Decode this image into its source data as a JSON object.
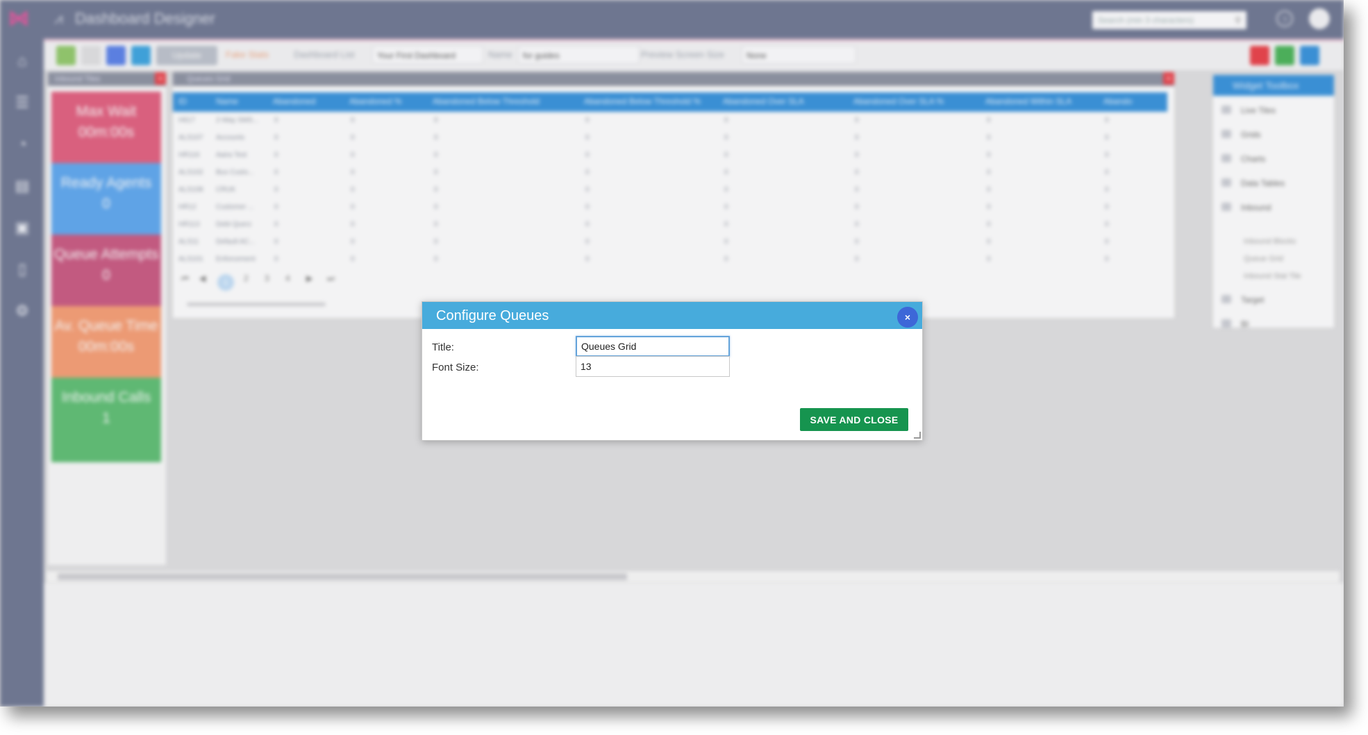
{
  "app": {
    "title": "Dashboard Designer",
    "search_placeholder": "Search (min 3 characters)"
  },
  "toolbar": {
    "update_label": "Update",
    "fake_stats_label": "Fake Stats",
    "dashboard_list_label": "Dashboard List",
    "dashboard_list_value": "Your First Dashboard",
    "name_label": "Name",
    "name_value": "for guides",
    "preview_label": "Preview Screen Size",
    "preview_value": "None"
  },
  "tiles_panel": {
    "title": "Inbound Tiles",
    "tiles": [
      {
        "label": "Max Wait",
        "value": "00m:00s",
        "color": "#d9607e"
      },
      {
        "label": "Ready Agents",
        "value": "0",
        "color": "#5fa3e6"
      },
      {
        "label": "Queue Attempts",
        "value": "0",
        "color": "#c25a80"
      },
      {
        "label": "Av. Queue Time",
        "value": "00m:00s",
        "color": "#ec9a74"
      },
      {
        "label": "Inbound Calls",
        "value": "1",
        "color": "#5fb873"
      }
    ]
  },
  "grid": {
    "title": "Queues Grid",
    "columns": [
      "ID",
      "Name",
      "Abandoned",
      "Abandoned %",
      "Abandoned Below Threshold",
      "Abandoned Below Threshold %",
      "Abandoned Over SLA",
      "Abandoned Over SLA %",
      "Abandoned Within SLA",
      "Abando"
    ],
    "rows": [
      [
        "H617",
        "2-Way SMS..."
      ],
      [
        "ALS107",
        "Accounts"
      ],
      [
        "HR116",
        "Aaira Test"
      ],
      [
        "ALS102",
        "Bus Custo..."
      ],
      [
        "ALS108",
        "CRUK"
      ],
      [
        "HR12",
        "Customer ..."
      ],
      [
        "HR113",
        "Debt Querz"
      ],
      [
        "ALS11",
        "Default AC..."
      ],
      [
        "ALS101",
        "Enforcement"
      ]
    ],
    "zero": "0",
    "pages": [
      "1",
      "2",
      "3",
      "4"
    ]
  },
  "toolbox": {
    "title": "Widget Toolbox",
    "items": [
      "Live Tiles",
      "Grids",
      "Charts",
      "Data Tables",
      "Inbound"
    ],
    "sub_items": [
      "Inbound Blocks",
      "Queue Grid",
      "Inbound Stat Tile"
    ],
    "items2": [
      "Target",
      "BI"
    ]
  },
  "modal": {
    "title": "Configure Queues",
    "close_symbol": "×",
    "title_label": "Title:",
    "title_value": "Queues Grid",
    "font_size_label": "Font Size:",
    "font_size_value": "13",
    "save_label": "SAVE AND CLOSE"
  },
  "colors": {
    "modal_header": "#47abdc",
    "close_button": "#3d67d8",
    "save_button": "#16944f",
    "sidebar": "#6e7690"
  }
}
